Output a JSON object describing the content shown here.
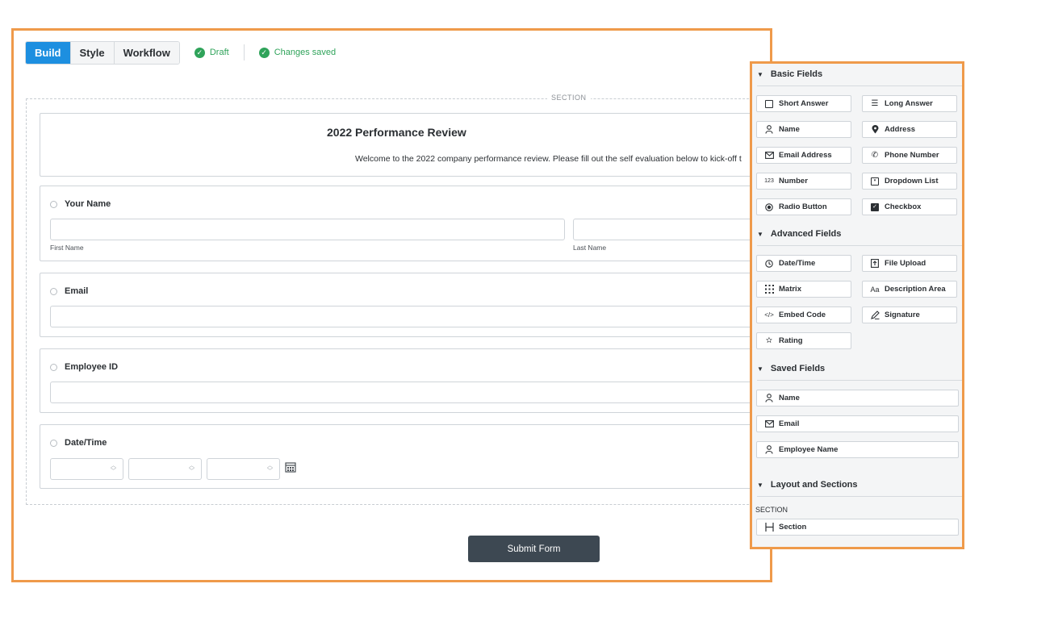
{
  "toolbar": {
    "tabs": [
      "Build",
      "Style",
      "Workflow"
    ],
    "status_draft": "Draft",
    "status_saved": "Changes saved"
  },
  "section": {
    "label": "SECTION"
  },
  "form": {
    "title": "2022 Performance Review",
    "description": "Welcome to the 2022 company performance review. Please fill out the self evaluation below to kick-off t",
    "fields": {
      "name": {
        "label": "Your Name",
        "first": "First Name",
        "last": "Last Name"
      },
      "email": {
        "label": "Email"
      },
      "employee_id": {
        "label": "Employee ID"
      },
      "datetime": {
        "label": "Date/Time"
      }
    },
    "submit": "Submit Form"
  },
  "panel": {
    "basic": {
      "title": "Basic Fields",
      "items": [
        "Short Answer",
        "Long Answer",
        "Name",
        "Address",
        "Email Address",
        "Phone Number",
        "Number",
        "Dropdown List",
        "Radio Button",
        "Checkbox"
      ],
      "icons": [
        "short-answer-icon",
        "long-answer-icon",
        "person-icon",
        "map-pin-icon",
        "envelope-icon",
        "phone-icon",
        "number-icon",
        "dropdown-icon",
        "radio-icon",
        "checkbox-icon"
      ]
    },
    "advanced": {
      "title": "Advanced Fields",
      "items": [
        "Date/Time",
        "File Upload",
        "Matrix",
        "Description Area",
        "Embed Code",
        "Signature",
        "Rating"
      ],
      "icons": [
        "clock-icon",
        "upload-icon",
        "grid-icon",
        "text-icon",
        "code-icon",
        "pen-icon",
        "star-icon"
      ]
    },
    "saved": {
      "title": "Saved Fields",
      "items": [
        "Name",
        "Email",
        "Employee Name"
      ],
      "icons": [
        "person-icon",
        "envelope-icon",
        "person-icon"
      ]
    },
    "layout": {
      "title": "Layout and Sections",
      "sublabel": "SECTION",
      "items": [
        "Section"
      ],
      "icons": [
        "section-icon"
      ]
    },
    "number_glyph": "123",
    "text_glyph": "Aa"
  },
  "colors": {
    "accent": "#1d8fe0",
    "success": "#2fa35a",
    "highlight": "#ef9a4a",
    "button_dark": "#3d4852"
  }
}
